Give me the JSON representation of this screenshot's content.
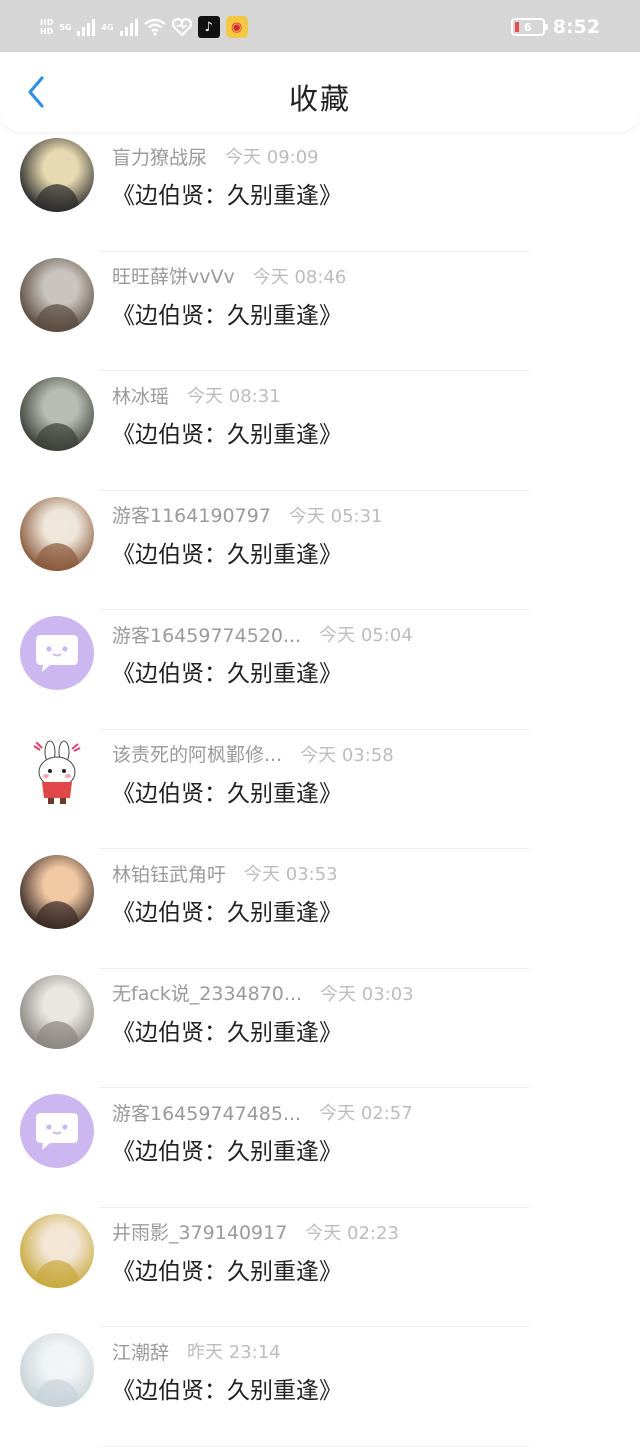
{
  "status": {
    "net1": "HD",
    "net2": "5G",
    "net3": "4G",
    "battery": "6",
    "time": "8:52"
  },
  "header": {
    "title": "收藏"
  },
  "favorites": [
    {
      "user": "盲力獠战尿",
      "time": "今天 09:09",
      "title": "《边伯贤：久别重逢》",
      "avatar": "photo",
      "colors": [
        "#2b2b2b",
        "#e7d9b0"
      ]
    },
    {
      "user": "旺旺薛饼vvVv",
      "time": "今天 08:46",
      "title": "《边伯贤：久别重逢》",
      "avatar": "photo",
      "colors": [
        "#5a4a40",
        "#c9c4bd"
      ]
    },
    {
      "user": "林冰瑶",
      "time": "今天 08:31",
      "title": "《边伯贤：久别重逢》",
      "avatar": "photo",
      "colors": [
        "#3d4038",
        "#b9bcb0"
      ]
    },
    {
      "user": "游客1164190797",
      "time": "今天 05:31",
      "title": "《边伯贤：久别重逢》",
      "avatar": "photo",
      "colors": [
        "#8a5a3c",
        "#efe6da"
      ]
    },
    {
      "user": "游客16459774520...",
      "time": "今天 05:04",
      "title": "《边伯贤：久别重逢》",
      "avatar": "default",
      "colors": [
        "#cdb7f0",
        "#ffffff"
      ]
    },
    {
      "user": "该责死的阿枫鄞修...",
      "time": "今天 03:58",
      "title": "《边伯贤：久别重逢》",
      "avatar": "rabbit",
      "colors": [
        "#ffffff",
        "#e0416a"
      ]
    },
    {
      "user": "林铂钰武角吁",
      "time": "今天 03:53",
      "title": "《边伯贤：久别重逢》",
      "avatar": "photo",
      "colors": [
        "#3a2a26",
        "#f1c9a3"
      ]
    },
    {
      "user": "无fack说_2334870...",
      "time": "今天 03:03",
      "title": "《边伯贤：久别重逢》",
      "avatar": "photo",
      "colors": [
        "#8b8680",
        "#eae6e1"
      ]
    },
    {
      "user": "游客16459747485...",
      "time": "今天 02:57",
      "title": "《边伯贤：久别重逢》",
      "avatar": "default",
      "colors": [
        "#cdb7f0",
        "#ffffff"
      ]
    },
    {
      "user": "井雨影_379140917",
      "time": "今天 02:23",
      "title": "《边伯贤：久别重逢》",
      "avatar": "photo",
      "colors": [
        "#c8a93e",
        "#f3e6d6"
      ]
    },
    {
      "user": "江潮辞",
      "time": "昨天 23:14",
      "title": "《边伯贤：久别重逢》",
      "avatar": "photo",
      "colors": [
        "#c7d3d8",
        "#f1f4f5"
      ]
    }
  ],
  "theme": {
    "accent": "#2f8fe6",
    "statusbar": "#d6d6d6",
    "default_avatar": "#cdb7f0"
  }
}
